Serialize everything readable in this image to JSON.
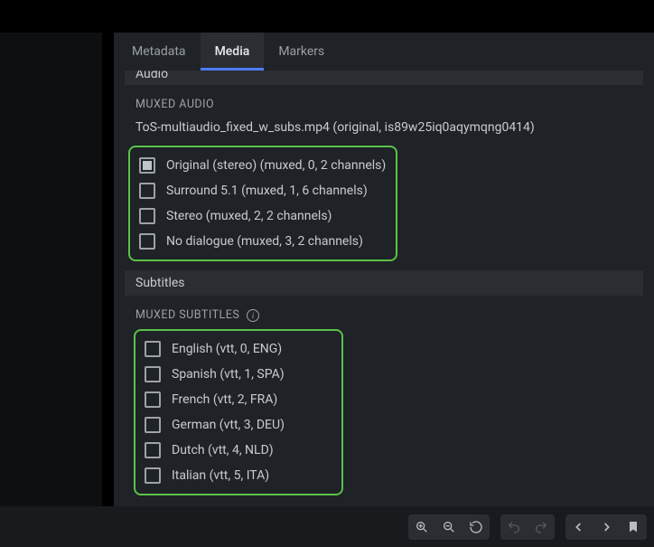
{
  "tabs": {
    "metadata": "Metadata",
    "media": "Media",
    "markers": "Markers"
  },
  "audio": {
    "section_label": "Audio",
    "subheader": "MUXED AUDIO",
    "file_line": "ToS-multiaudio_fixed_w_subs.mp4 (original, is89w25iq0aqymqng0414)",
    "tracks": [
      {
        "label": "Original (stereo) (muxed, 0, 2 channels)",
        "state": "indeterminate"
      },
      {
        "label": "Surround 5.1 (muxed, 1, 6 channels)",
        "state": "unchecked"
      },
      {
        "label": "Stereo (muxed, 2, 2 channels)",
        "state": "unchecked"
      },
      {
        "label": "No dialogue (muxed, 3, 2 channels)",
        "state": "unchecked"
      }
    ]
  },
  "subtitles": {
    "section_label": "Subtitles",
    "subheader": "MUXED SUBTITLES",
    "tracks": [
      {
        "label": "English (vtt, 0, ENG)",
        "state": "unchecked"
      },
      {
        "label": "Spanish (vtt, 1, SPA)",
        "state": "unchecked"
      },
      {
        "label": "French (vtt, 2, FRA)",
        "state": "unchecked"
      },
      {
        "label": "German (vtt, 3, DEU)",
        "state": "unchecked"
      },
      {
        "label": "Dutch (vtt, 4, NLD)",
        "state": "unchecked"
      },
      {
        "label": "Italian (vtt, 5, ITA)",
        "state": "unchecked"
      }
    ]
  },
  "toolbar": {
    "zoom_in": "zoom-in",
    "zoom_out": "zoom-out",
    "reset": "reset",
    "undo": "undo",
    "redo": "redo",
    "prev": "prev",
    "next": "next",
    "tag": "tag"
  }
}
